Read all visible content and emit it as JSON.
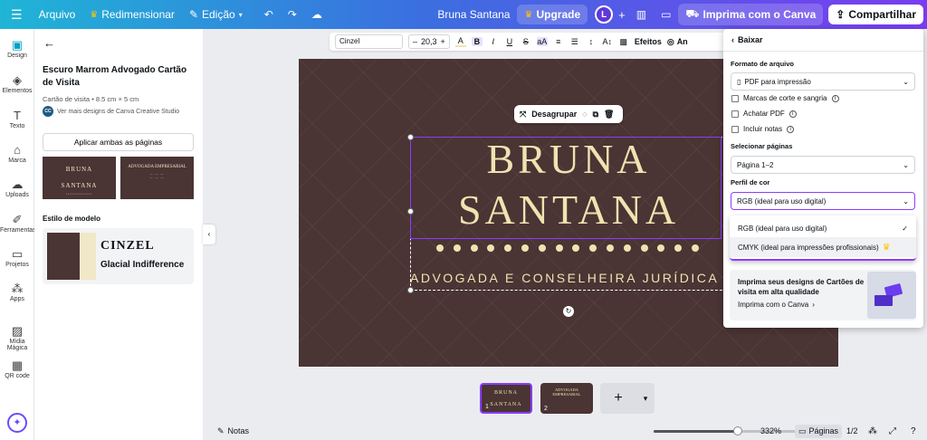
{
  "topbar": {
    "menu_icon": "hamburger-icon",
    "file": "Arquivo",
    "resize": "Redimensionar",
    "edit": "Edição",
    "doc_title": "Bruna Santana",
    "upgrade": "Upgrade",
    "avatar_initial": "L",
    "print_canva": "Imprima com o Canva",
    "share": "Compartilhar"
  },
  "rail": {
    "items": [
      {
        "label": "Design",
        "icon": "design-icon"
      },
      {
        "label": "Elementos",
        "icon": "elements-icon"
      },
      {
        "label": "Texto",
        "icon": "text-icon"
      },
      {
        "label": "Marca",
        "icon": "brand-icon"
      },
      {
        "label": "Uploads",
        "icon": "upload-icon"
      },
      {
        "label": "Ferramentas",
        "icon": "tools-icon"
      },
      {
        "label": "Projetos",
        "icon": "folder-icon"
      },
      {
        "label": "Apps",
        "icon": "apps-icon"
      },
      {
        "label": "Mídia Mágica",
        "icon": "magic-media-icon"
      },
      {
        "label": "QR code",
        "icon": "qr-code-icon"
      }
    ]
  },
  "panel": {
    "title": "Escuro Marrom Advogado Cartão de Visita",
    "subtitle": "Cartão de visita • 8.5 cm × 5 cm",
    "creator_initials": "CC",
    "creator": "Ver mais designs de Canva Creative Studio",
    "apply_both": "Aplicar ambas as páginas",
    "thumb1": {
      "line1": "BRUNA",
      "line2": "SANTANA"
    },
    "thumb2": {
      "line1": "ADVOGADA EMPRESARIAL"
    },
    "style_section": "Estilo de modelo",
    "style_font1": "CINZEL",
    "style_font2": "Glacial Indifference"
  },
  "format_toolbar": {
    "font": "Cinzel",
    "size": "20,3",
    "effects": "Efeitos",
    "animate": "An"
  },
  "canvas": {
    "name_line1": "BRUNA",
    "name_line2": "SANTANA",
    "tagline": "ADVOGADA E CONSELHEIRA JURÍDICA",
    "dot_count": 16,
    "ungroup": "Desagrupar"
  },
  "pages": {
    "page1_number": "1",
    "page2_number": "2",
    "thumb1": {
      "line1": "BRUNA",
      "line2": "SANTANA"
    },
    "thumb2": {
      "line1": "ADVOGADA EMPRESARIAL"
    }
  },
  "bottombar": {
    "notes": "Notas",
    "zoom": "332%",
    "zoom_slider_fraction": 0.58,
    "pages": "Páginas",
    "page_count": "1/2"
  },
  "download": {
    "back": "Baixar",
    "file_format_label": "Formato de arquivo",
    "file_format_value": "PDF para impressão",
    "crop_marks": "Marcas de corte e sangria",
    "flatten_pdf": "Achatar PDF",
    "include_notes": "Incluir notas",
    "pages_label": "Selecionar páginas",
    "pages_value": "Página 1–2",
    "color_profile_label": "Perfil de cor",
    "color_profile_value": "RGB (ideal para uso digital)",
    "options": [
      {
        "label": "RGB (ideal para uso digital)",
        "selected": true
      },
      {
        "label": "CMYK (ideal para impressões profissionais)",
        "selected": false
      }
    ],
    "promo_text": "Imprima seus designs de Cartões de visita em alta qualidade",
    "promo_link": "Imprima com o Canva"
  },
  "colors": {
    "card_bg": "#4a3434",
    "card_text": "#efe4b0",
    "accent": "#8b3dff"
  }
}
